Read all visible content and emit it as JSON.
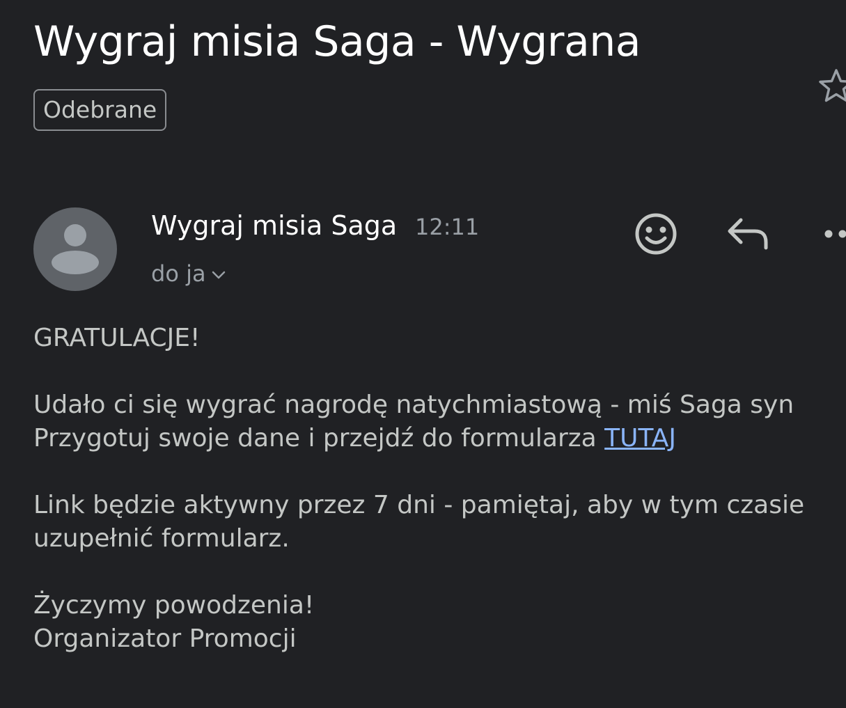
{
  "email": {
    "subject": "Wygraj misia Saga - Wygrana",
    "label": "Odebrane",
    "sender": "Wygraj misia Saga",
    "time": "12:11",
    "recipient": "do ja",
    "body": {
      "greeting": "GRATULACJE!",
      "line1": "Udało ci się wygrać nagrodę natychmiastową - miś Saga syn",
      "line2_prefix": "Przygotuj swoje dane i przejdź do formularza ",
      "link_text": "TUTAJ",
      "line3": "Link będzie aktywny przez 7 dni - pamiętaj, aby w tym czasie",
      "line4": "uzupełnić formularz.",
      "closing": "Życzymy powodzenia!",
      "signature": "Organizator Promocji"
    }
  },
  "icons": {
    "star": "star-outline-icon",
    "avatar": "person-icon",
    "emoji": "add-reaction-icon",
    "reply": "reply-icon",
    "more": "more-horizontal-icon",
    "chevron": "chevron-down-icon"
  },
  "colors": {
    "background": "#202124",
    "text_primary": "#ffffff",
    "text_body": "#c4c7c5",
    "text_secondary": "#9aa0a6",
    "link": "#8ab4f8",
    "avatar_bg": "#5f6368"
  }
}
